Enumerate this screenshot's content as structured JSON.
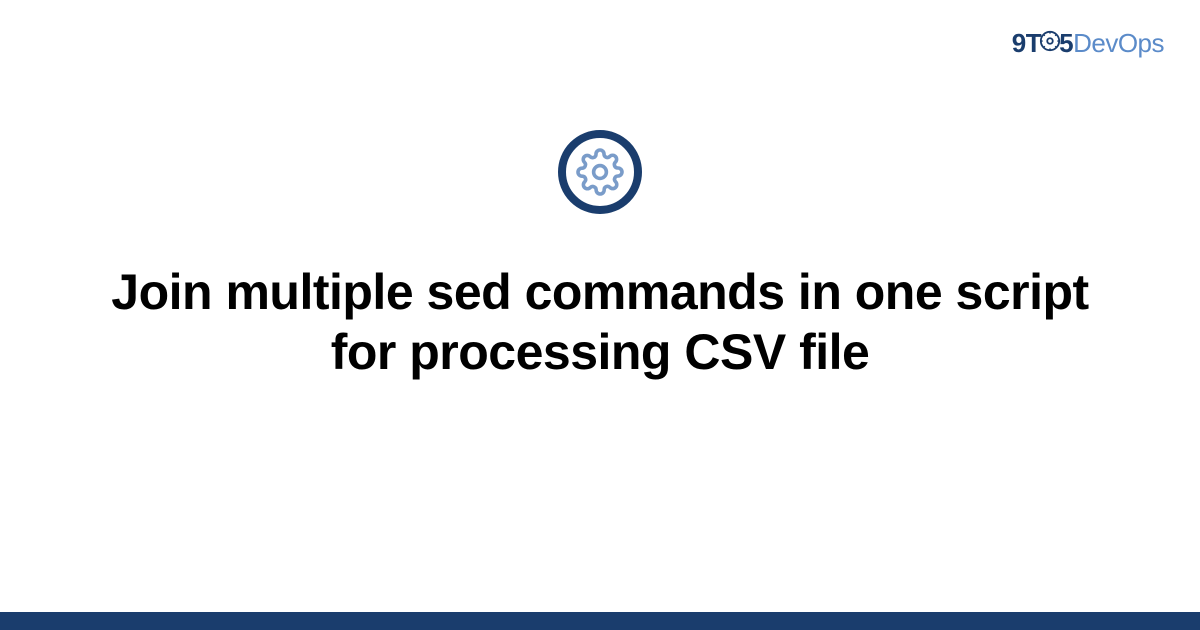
{
  "logo": {
    "part1": "9T",
    "part2": "5",
    "part3": "DevOps"
  },
  "title": "Join multiple sed commands in one script for processing CSV file",
  "colors": {
    "primary": "#1a3d6d",
    "accent": "#5b8bc9",
    "iconStroke": "#7a9cc9"
  }
}
